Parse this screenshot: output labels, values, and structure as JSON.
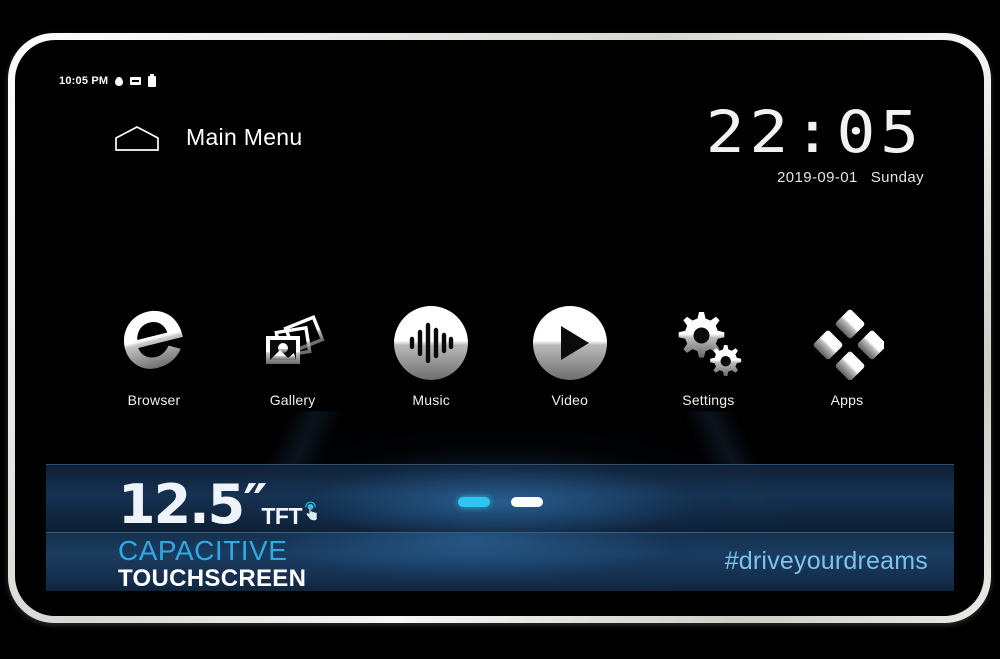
{
  "status_bar": {
    "time": "10:05 PM",
    "icons": [
      "location-drop-icon",
      "sd-card-icon",
      "battery-icon"
    ]
  },
  "header": {
    "home_icon": "home-icon",
    "title": "Main Menu",
    "clock": {
      "time": "22:05",
      "hours": "22",
      "separator": ":",
      "minutes": "05",
      "date": "2019-09-01",
      "weekday": "Sunday"
    }
  },
  "apps": [
    {
      "label": "Browser",
      "icon": "edge-browser-icon"
    },
    {
      "label": "Gallery",
      "icon": "photo-gallery-icon"
    },
    {
      "label": "Music",
      "icon": "music-waveform-icon"
    },
    {
      "label": "Video",
      "icon": "video-play-icon"
    },
    {
      "label": "Settings",
      "icon": "gears-settings-icon"
    },
    {
      "label": "Apps",
      "icon": "apps-diamonds-icon"
    }
  ],
  "page_dots": [
    {
      "state": "active"
    },
    {
      "state": "inactive"
    }
  ],
  "promo": {
    "size_number": "12.5″",
    "panel_type": "TFT",
    "touch_icon": "touch-hand-icon",
    "line1": "CAPACITIVE",
    "line2": "TOUCHSCREEN",
    "hashtag": "#driveyourdreams"
  },
  "nav_bar": [
    {
      "name": "volume-down-icon"
    },
    {
      "name": "back-triangle-icon"
    },
    {
      "name": "home-circle-icon"
    },
    {
      "name": "recents-square-icon"
    },
    {
      "name": "volume-up-icon"
    },
    {
      "name": "hide-navbar-down-arrow-icon"
    }
  ],
  "nav_camera_button": {
    "icon": "camera-icon"
  },
  "colors": {
    "accent_cyan": "#2ec6f0",
    "capacitive_blue": "#33a8e0",
    "hashtag_blue": "#7cc3e8",
    "screen_bg": "#000000",
    "band_blue": "#1a3c60",
    "bezel": "#e9e7e3"
  }
}
